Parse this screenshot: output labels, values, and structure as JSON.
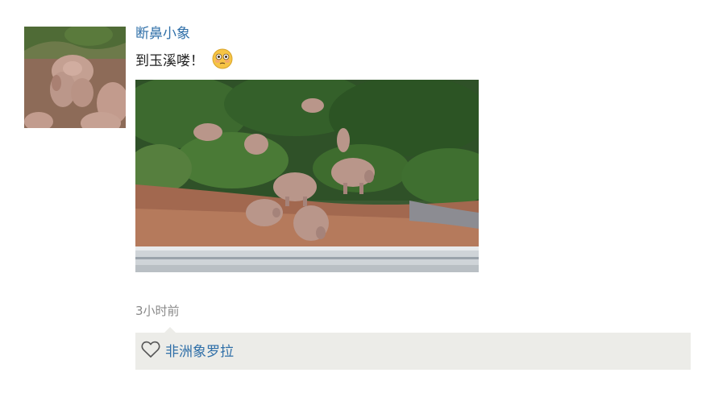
{
  "post": {
    "author": "断鼻小象",
    "text": "到玉溪喽！",
    "emoji": "flushed-face-emoji",
    "timestamp": "3小时前"
  },
  "likes": {
    "icon": "heart-outline-icon",
    "names": "非洲象罗拉"
  },
  "colors": {
    "name_link": "#2f6fa8",
    "like_bg": "#ecece8",
    "timestamp": "#8a8a8a"
  }
}
